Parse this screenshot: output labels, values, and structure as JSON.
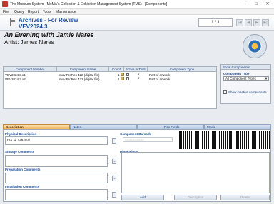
{
  "window": {
    "title": "The Museum System - MoMA's Collection & Exhibition Management System (TMS) - [Components]",
    "minimize": "–",
    "maximize": "□",
    "close": "✕"
  },
  "menu": [
    "File",
    "Query",
    "Report",
    "Tools",
    "Maintenance"
  ],
  "header": {
    "title": "Archives - For Review",
    "record": "VEV2024.3",
    "pager": "1 / 1",
    "nav": [
      "|◀",
      "◀",
      "▶",
      "▶|"
    ]
  },
  "object": {
    "title": "An Evening with Jamie Nares",
    "artist": "Artist: James Nares"
  },
  "grid": {
    "columns": [
      "Component Number",
      "Component Name",
      "Count",
      "Active in TMS",
      "Component Type"
    ],
    "rows": [
      {
        "number": "VEV2024.3.x1",
        "name": "mov ProRes 422 (digital file)",
        "count": "1",
        "active": "✔",
        "type": "Part of artwork"
      },
      {
        "number": "VEV2024.3.x2",
        "name": "mov ProRes 422 (digital file)",
        "count": "1",
        "active": "✔",
        "type": "Part of artwork"
      }
    ]
  },
  "show_components": {
    "heading": "Show Components",
    "type_label": "Component Type",
    "type_value": "All Component Types",
    "inactive_label": "Show inactive components"
  },
  "tabs": [
    "Description",
    "Notes",
    "Flex Fields",
    "Media"
  ],
  "description": {
    "physical_label": "Physical Description",
    "physical_value": "PIX_1_436.mov",
    "storage_label": "Storage Comments",
    "preparation_label": "Preparation Comments",
    "installation_label": "Installation Comments",
    "barcode_label": "Component Barcode",
    "barcode_placeholder": "XXXXXXXXXX",
    "dimensions_label": "Dimensions"
  },
  "buttons": {
    "add": "Add",
    "description": "Description",
    "delete": "Delete"
  }
}
